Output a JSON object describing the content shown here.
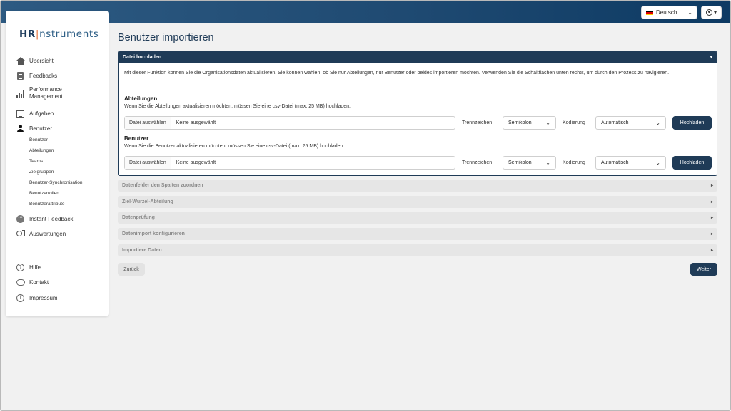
{
  "header": {
    "language": "Deutsch",
    "user_menu_caret": "▾"
  },
  "sidebar": {
    "logo": {
      "hr": "HR",
      "bar": "|",
      "rest": "nstruments"
    },
    "items": [
      {
        "label": "Übersicht",
        "icon": "home-icon"
      },
      {
        "label": "Feedbacks",
        "icon": "clipboard-icon"
      },
      {
        "label": "Performance Management",
        "icon": "bar-chart-icon"
      },
      {
        "label": "Aufgaben",
        "icon": "task-list-icon"
      },
      {
        "label": "Benutzer",
        "icon": "user-icon"
      },
      {
        "label": "Instant Feedback",
        "icon": "chat-icon"
      },
      {
        "label": "Auswertungen",
        "icon": "analytics-icon"
      }
    ],
    "sub_items": [
      "Benutzer",
      "Abteilungen",
      "Teams",
      "Zielgruppen",
      "Benutzer-Synchronisation",
      "Benutzerrollen",
      "Benutzerattribute"
    ],
    "footer_items": [
      {
        "label": "Hilfe",
        "icon": "help-icon"
      },
      {
        "label": "Kontakt",
        "icon": "contact-icon"
      },
      {
        "label": "Impressum",
        "icon": "info-icon"
      }
    ]
  },
  "main": {
    "title": "Benutzer importieren",
    "upload": {
      "header": "Datei hochladen",
      "intro": "Mit dieser Funktion können Sie die Organisationsdaten aktualisieren. Sie können wählen, ob Sie nur Abteilungen, nur Benutzer oder beides importieren möchten. Verwenden Sie die Schaltflächen unten rechts, um durch den Prozess zu navigieren.",
      "sections": [
        {
          "title": "Abteilungen",
          "desc": "Wenn Sie die Abteilungen aktualisieren möchten, müssen Sie eine csv-Datei (max. 25 MB) hochladen:",
          "file_button": "Datei auswählen",
          "file_name": "Keine ausgewählt",
          "separator_label": "Trennzeichen",
          "separator_value": "Semikolon",
          "encoding_label": "Kodierung",
          "encoding_value": "Automatisch",
          "upload_button": "Hochladen"
        },
        {
          "title": "Benutzer",
          "desc": "Wenn Sie die Benutzer aktualisieren möchten, müssen Sie eine csv-Datei (max. 25 MB) hochladen:",
          "file_button": "Datei auswählen",
          "file_name": "Keine ausgewählt",
          "separator_label": "Trennzeichen",
          "separator_value": "Semikolon",
          "encoding_label": "Kodierung",
          "encoding_value": "Automatisch",
          "upload_button": "Hochladen"
        }
      ]
    },
    "steps": [
      "Datenfelder den Spalten zuordnen",
      "Ziel-Wurzel-Abteilung",
      "Datenprüfung",
      "Datenimport konfigurieren",
      "Importiere Daten"
    ],
    "back_button": "Zurück",
    "next_button": "Weiter"
  }
}
